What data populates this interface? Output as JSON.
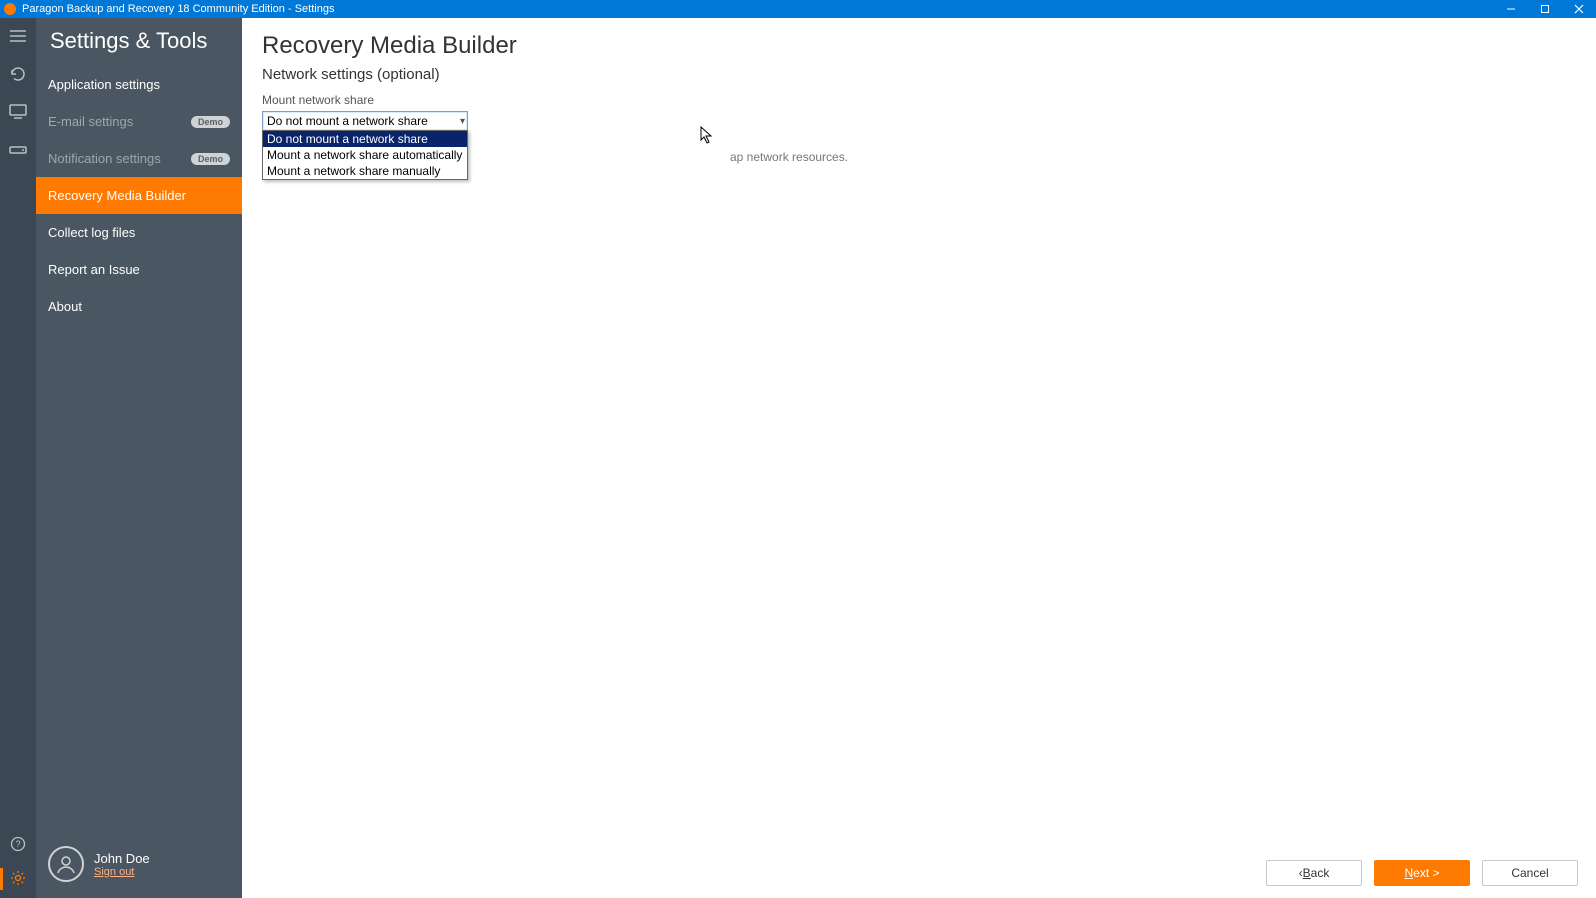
{
  "window": {
    "title": "Paragon Backup and Recovery 18 Community Edition - Settings"
  },
  "sidebar": {
    "title": "Settings & Tools",
    "items": [
      {
        "label": "Application settings",
        "badge": ""
      },
      {
        "label": "E-mail settings",
        "badge": "Demo"
      },
      {
        "label": "Notification settings",
        "badge": "Demo"
      },
      {
        "label": "Recovery Media Builder",
        "badge": ""
      },
      {
        "label": "Collect log files",
        "badge": ""
      },
      {
        "label": "Report an Issue",
        "badge": ""
      },
      {
        "label": "About",
        "badge": ""
      }
    ],
    "user": {
      "name": "John Doe",
      "signout": "Sign out"
    }
  },
  "main": {
    "title": "Recovery Media Builder",
    "subtitle": "Network settings (optional)",
    "field_label": "Mount network share",
    "combo_value": "Do not mount a network share",
    "options": [
      "Do not mount a network share",
      "Mount a network share automatically",
      "Mount a network share manually"
    ],
    "hint_tail": "ap network resources."
  },
  "footer": {
    "back_prefix": "‹ ",
    "back_letter": "B",
    "back_rest": "ack",
    "next_letter": "N",
    "next_rest": "ext >",
    "cancel": "Cancel"
  }
}
